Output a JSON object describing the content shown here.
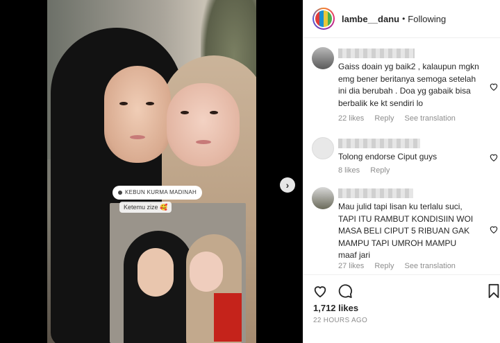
{
  "post": {
    "location_tag": "KEBUN KURMA MADINAH",
    "story_caption": "Ketemu zize 🥰"
  },
  "header": {
    "username": "lambe__danu",
    "separator": "•",
    "follow_status": "Following"
  },
  "comments": [
    {
      "text": "Gaiss doain yg baik2 , kalaupun mgkn emg bener beritanya semoga setelah ini dia berubah . Doa yg gabaik bisa berbalik ke kt sendiri lo",
      "likes": "22 likes",
      "reply": "Reply",
      "translation": "See translation"
    },
    {
      "text": "Tolong endorse Ciput guys",
      "likes": "8 likes",
      "reply": "Reply",
      "translation": ""
    },
    {
      "text": "Mau julid tapi lisan ku terlalu suci,\nTAPI ITU RAMBUT KONDISIIN WOI\nMASA BELI CIPUT 5 RIBUAN GAK\nMAMPU TAPI UMROH MAMPU\nmaaf jari",
      "likes": "27 likes",
      "reply": "Reply",
      "translation": "See translation"
    }
  ],
  "footer": {
    "likes_count": "1,712 likes",
    "timestamp": "22 HOURS AGO"
  },
  "icons": {
    "next": "chevron-right-icon",
    "like": "heart-icon",
    "comment": "comment-bubble-icon",
    "save": "bookmark-icon"
  },
  "colors": {
    "text": "#262626",
    "muted": "#8e8e8e",
    "border": "#efefef"
  }
}
